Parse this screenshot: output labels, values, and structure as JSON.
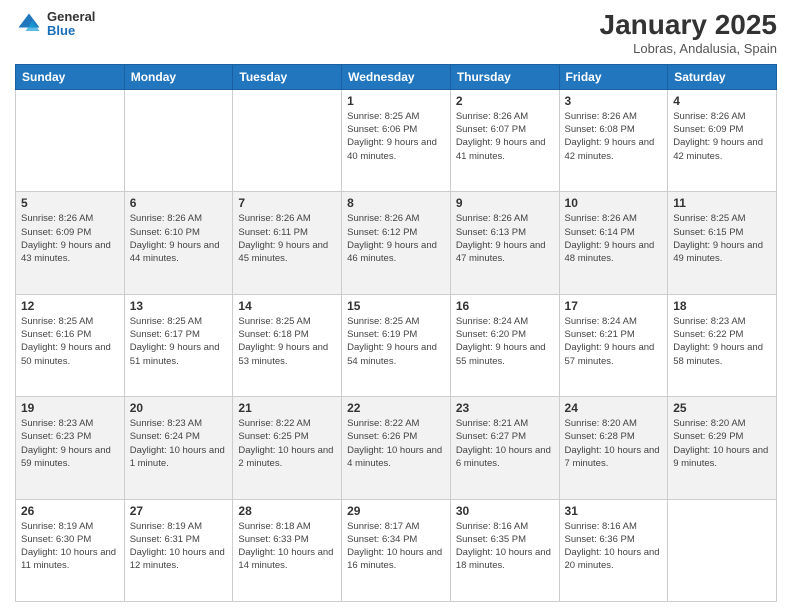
{
  "header": {
    "logo": {
      "general": "General",
      "blue": "Blue"
    },
    "title": "January 2025",
    "subtitle": "Lobras, Andalusia, Spain"
  },
  "days_of_week": [
    "Sunday",
    "Monday",
    "Tuesday",
    "Wednesday",
    "Thursday",
    "Friday",
    "Saturday"
  ],
  "weeks": [
    [
      {
        "num": "",
        "info": ""
      },
      {
        "num": "",
        "info": ""
      },
      {
        "num": "",
        "info": ""
      },
      {
        "num": "1",
        "info": "Sunrise: 8:25 AM\nSunset: 6:06 PM\nDaylight: 9 hours and 40 minutes."
      },
      {
        "num": "2",
        "info": "Sunrise: 8:26 AM\nSunset: 6:07 PM\nDaylight: 9 hours and 41 minutes."
      },
      {
        "num": "3",
        "info": "Sunrise: 8:26 AM\nSunset: 6:08 PM\nDaylight: 9 hours and 42 minutes."
      },
      {
        "num": "4",
        "info": "Sunrise: 8:26 AM\nSunset: 6:09 PM\nDaylight: 9 hours and 42 minutes."
      }
    ],
    [
      {
        "num": "5",
        "info": "Sunrise: 8:26 AM\nSunset: 6:09 PM\nDaylight: 9 hours and 43 minutes."
      },
      {
        "num": "6",
        "info": "Sunrise: 8:26 AM\nSunset: 6:10 PM\nDaylight: 9 hours and 44 minutes."
      },
      {
        "num": "7",
        "info": "Sunrise: 8:26 AM\nSunset: 6:11 PM\nDaylight: 9 hours and 45 minutes."
      },
      {
        "num": "8",
        "info": "Sunrise: 8:26 AM\nSunset: 6:12 PM\nDaylight: 9 hours and 46 minutes."
      },
      {
        "num": "9",
        "info": "Sunrise: 8:26 AM\nSunset: 6:13 PM\nDaylight: 9 hours and 47 minutes."
      },
      {
        "num": "10",
        "info": "Sunrise: 8:26 AM\nSunset: 6:14 PM\nDaylight: 9 hours and 48 minutes."
      },
      {
        "num": "11",
        "info": "Sunrise: 8:25 AM\nSunset: 6:15 PM\nDaylight: 9 hours and 49 minutes."
      }
    ],
    [
      {
        "num": "12",
        "info": "Sunrise: 8:25 AM\nSunset: 6:16 PM\nDaylight: 9 hours and 50 minutes."
      },
      {
        "num": "13",
        "info": "Sunrise: 8:25 AM\nSunset: 6:17 PM\nDaylight: 9 hours and 51 minutes."
      },
      {
        "num": "14",
        "info": "Sunrise: 8:25 AM\nSunset: 6:18 PM\nDaylight: 9 hours and 53 minutes."
      },
      {
        "num": "15",
        "info": "Sunrise: 8:25 AM\nSunset: 6:19 PM\nDaylight: 9 hours and 54 minutes."
      },
      {
        "num": "16",
        "info": "Sunrise: 8:24 AM\nSunset: 6:20 PM\nDaylight: 9 hours and 55 minutes."
      },
      {
        "num": "17",
        "info": "Sunrise: 8:24 AM\nSunset: 6:21 PM\nDaylight: 9 hours and 57 minutes."
      },
      {
        "num": "18",
        "info": "Sunrise: 8:23 AM\nSunset: 6:22 PM\nDaylight: 9 hours and 58 minutes."
      }
    ],
    [
      {
        "num": "19",
        "info": "Sunrise: 8:23 AM\nSunset: 6:23 PM\nDaylight: 9 hours and 59 minutes."
      },
      {
        "num": "20",
        "info": "Sunrise: 8:23 AM\nSunset: 6:24 PM\nDaylight: 10 hours and 1 minute."
      },
      {
        "num": "21",
        "info": "Sunrise: 8:22 AM\nSunset: 6:25 PM\nDaylight: 10 hours and 2 minutes."
      },
      {
        "num": "22",
        "info": "Sunrise: 8:22 AM\nSunset: 6:26 PM\nDaylight: 10 hours and 4 minutes."
      },
      {
        "num": "23",
        "info": "Sunrise: 8:21 AM\nSunset: 6:27 PM\nDaylight: 10 hours and 6 minutes."
      },
      {
        "num": "24",
        "info": "Sunrise: 8:20 AM\nSunset: 6:28 PM\nDaylight: 10 hours and 7 minutes."
      },
      {
        "num": "25",
        "info": "Sunrise: 8:20 AM\nSunset: 6:29 PM\nDaylight: 10 hours and 9 minutes."
      }
    ],
    [
      {
        "num": "26",
        "info": "Sunrise: 8:19 AM\nSunset: 6:30 PM\nDaylight: 10 hours and 11 minutes."
      },
      {
        "num": "27",
        "info": "Sunrise: 8:19 AM\nSunset: 6:31 PM\nDaylight: 10 hours and 12 minutes."
      },
      {
        "num": "28",
        "info": "Sunrise: 8:18 AM\nSunset: 6:33 PM\nDaylight: 10 hours and 14 minutes."
      },
      {
        "num": "29",
        "info": "Sunrise: 8:17 AM\nSunset: 6:34 PM\nDaylight: 10 hours and 16 minutes."
      },
      {
        "num": "30",
        "info": "Sunrise: 8:16 AM\nSunset: 6:35 PM\nDaylight: 10 hours and 18 minutes."
      },
      {
        "num": "31",
        "info": "Sunrise: 8:16 AM\nSunset: 6:36 PM\nDaylight: 10 hours and 20 minutes."
      },
      {
        "num": "",
        "info": ""
      }
    ]
  ]
}
